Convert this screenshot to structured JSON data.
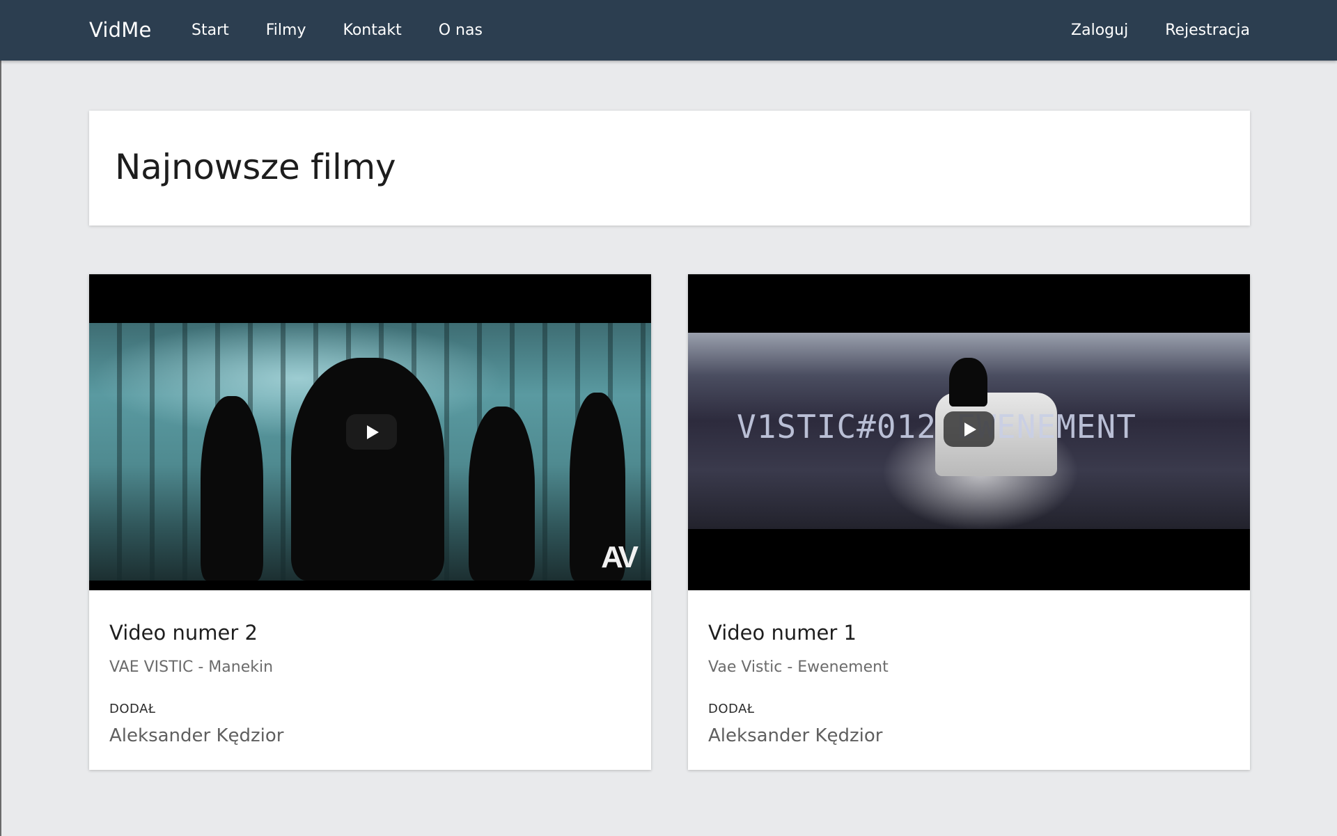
{
  "nav": {
    "brand": "VidMe",
    "links": [
      "Start",
      "Filmy",
      "Kontakt",
      "O nas"
    ],
    "right_links": [
      "Zaloguj",
      "Rejestracja"
    ]
  },
  "header": {
    "title": "Najnowsze filmy"
  },
  "videos": [
    {
      "title": "Video numer 2",
      "description": "VAE VISTIC - Manekin",
      "added_label": "DODAŁ",
      "author": "Aleksander Kędzior",
      "thumbnail_watermark": "AV"
    },
    {
      "title": "Video numer 1",
      "description": "Vae Vistic - Ewenement",
      "added_label": "DODAŁ",
      "author": "Aleksander Kędzior",
      "thumbnail_overlay": "V1STIC#012 EWENEMENT"
    }
  ],
  "colors": {
    "navbar": "#2c3e50",
    "page_background": "#e9eaec",
    "card_background": "#ffffff"
  }
}
